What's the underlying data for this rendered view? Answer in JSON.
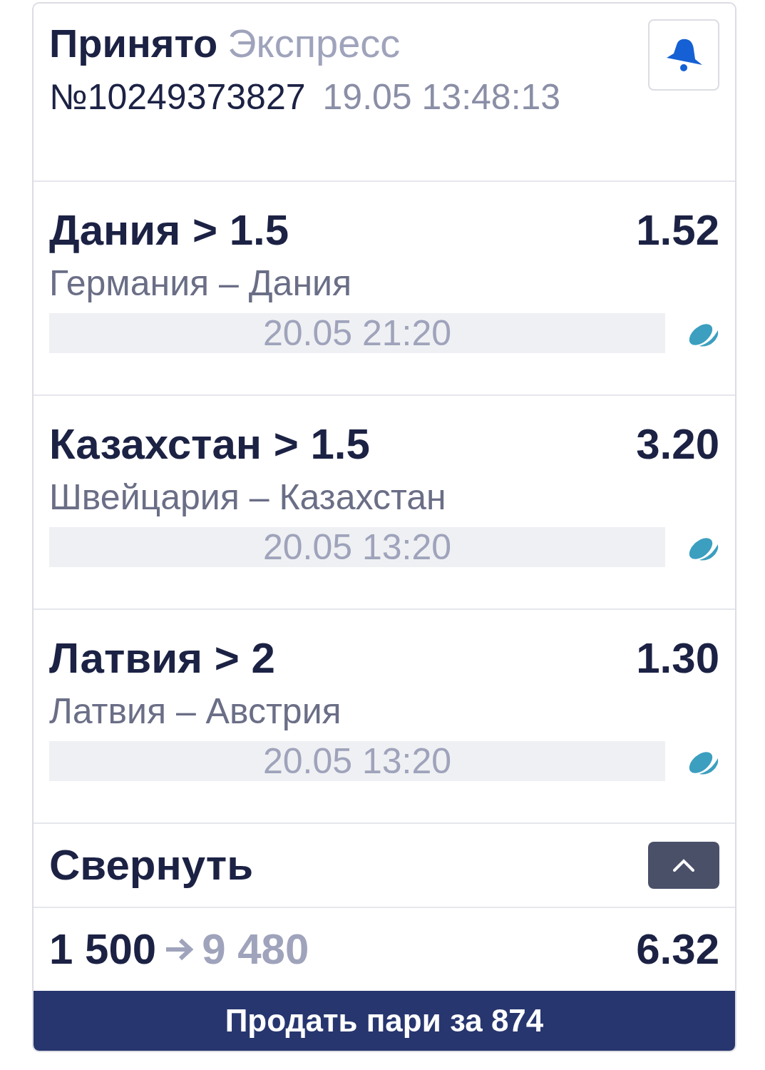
{
  "header": {
    "status": "Принято",
    "bet_type": "Экспресс",
    "number": "№10249373827",
    "datetime": "19.05 13:48:13"
  },
  "events": [
    {
      "selection": "Дания > 1.5",
      "odds": "1.52",
      "match": "Германия – Дания",
      "start": "20.05 21:20"
    },
    {
      "selection": "Казахстан > 1.5",
      "odds": "3.20",
      "match": "Швейцария – Казахстан",
      "start": "20.05 13:20"
    },
    {
      "selection": "Латвия > 2",
      "odds": "1.30",
      "match": "Латвия – Австрия",
      "start": "20.05 13:20"
    }
  ],
  "collapse": {
    "label": "Свернуть",
    "expanded": true
  },
  "summary": {
    "stake": "1 500",
    "payout": "9 480",
    "total_odds": "6.32"
  },
  "sell_button": "Продать пари за 874"
}
